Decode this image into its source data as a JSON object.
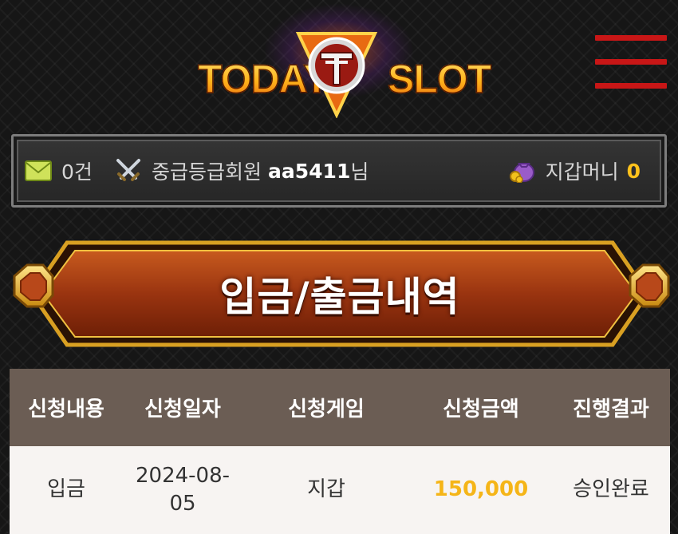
{
  "logo": {
    "left_text": "TODAY",
    "right_text": "SLOT",
    "accent": "#ffb21a"
  },
  "header": {
    "menu_icon": "hamburger-menu-icon",
    "menu_color": "#c81616"
  },
  "user_bar": {
    "message_count": "0건",
    "message_icon": "envelope-icon",
    "grade_icon": "crossed-swords-icon",
    "grade": "중급등급회원",
    "username": "aa5411",
    "honorific": "님",
    "wallet_icon": "money-bag-icon",
    "wallet_label": "지갑머니",
    "wallet_amount": "0",
    "wallet_color": "#ffc21c"
  },
  "page": {
    "title": "입금/출금내역"
  },
  "history": {
    "columns": [
      "신청내용",
      "신청일자",
      "신청게임",
      "신청금액",
      "진행결과"
    ],
    "rows": [
      {
        "type": "입금",
        "date_line1": "2024-08-",
        "date_line2": "05",
        "game": "지갑",
        "amount": "150,000",
        "status": "승인완료"
      }
    ],
    "amount_color": "#f5b518"
  }
}
